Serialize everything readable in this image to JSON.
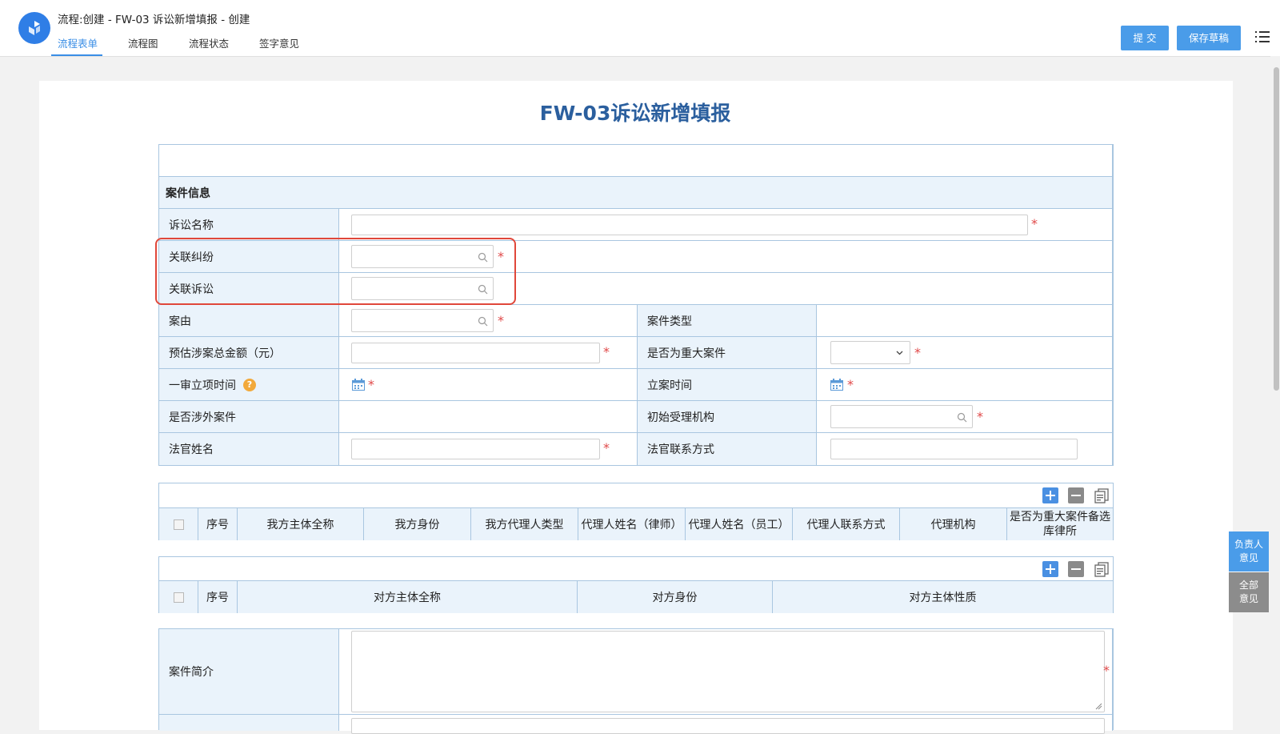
{
  "header": {
    "title": "流程:创建 - FW-03 诉讼新增填报 - 创建",
    "tabs": [
      {
        "label": "流程表单",
        "active": true
      },
      {
        "label": "流程图",
        "active": false
      },
      {
        "label": "流程状态",
        "active": false
      },
      {
        "label": "签字意见",
        "active": false
      }
    ],
    "submit_label": "提 交",
    "save_draft_label": "保存草稿",
    "menu_icon": "list-menu-icon"
  },
  "form": {
    "title": "FW-03诉讼新增填报",
    "section_case_info": "案件信息",
    "fields": {
      "lawsuit_name": "诉讼名称",
      "related_dispute": "关联纠纷",
      "related_lawsuit": "关联诉讼",
      "case_cause": "案由",
      "case_type": "案件类型",
      "estimated_amount": "预估涉案总金额（元）",
      "is_major_case": "是否为重大案件",
      "first_instance_time": "一审立项时间",
      "filing_time": "立案时间",
      "is_foreign_case": "是否涉外案件",
      "initial_institution": "初始受理机构",
      "judge_name": "法官姓名",
      "judge_contact": "法官联系方式",
      "case_summary": "案件简介"
    },
    "required_mark": "*",
    "help_mark": "?"
  },
  "our_party_table": {
    "headers": [
      "序号",
      "我方主体全称",
      "我方身份",
      "我方代理人类型",
      "代理人姓名（律师）",
      "代理人姓名（员工）",
      "代理人联系方式",
      "代理机构",
      "是否为重大案件备选库律所"
    ]
  },
  "opposing_party_table": {
    "headers": [
      "序号",
      "对方主体全称",
      "对方身份",
      "对方主体性质"
    ]
  },
  "side_panel": {
    "responsible_opinion": "负责人意见",
    "all_opinions": "全部意见"
  },
  "colors": {
    "accent": "#4a9ce9",
    "label_bg": "#eaf3fb",
    "border": "#a9c6e0",
    "required": "#e04848",
    "highlight": "#e0473a",
    "title": "#2b5f9e"
  }
}
